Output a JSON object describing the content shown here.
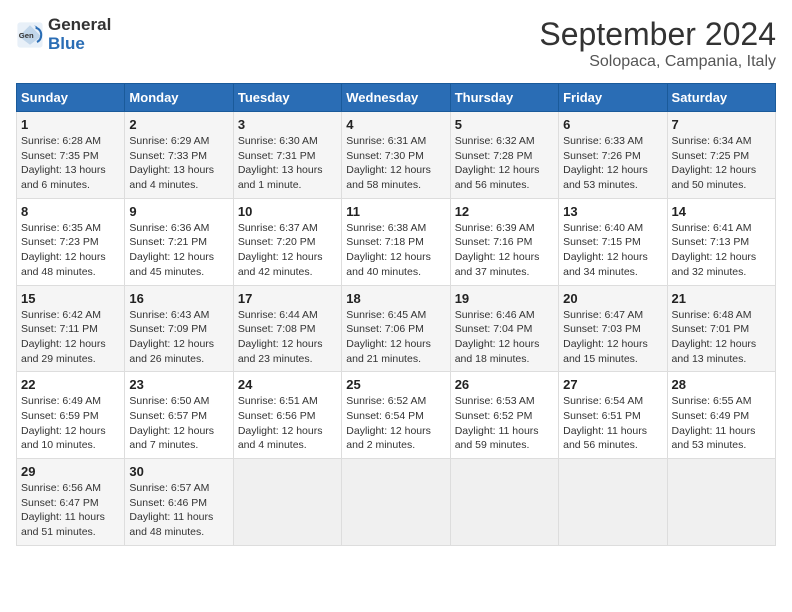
{
  "logo": {
    "text_general": "General",
    "text_blue": "Blue"
  },
  "header": {
    "month": "September 2024",
    "location": "Solopaca, Campania, Italy"
  },
  "days_of_week": [
    "Sunday",
    "Monday",
    "Tuesday",
    "Wednesday",
    "Thursday",
    "Friday",
    "Saturday"
  ],
  "weeks": [
    [
      {
        "day": "1",
        "info": "Sunrise: 6:28 AM\nSunset: 7:35 PM\nDaylight: 13 hours\nand 6 minutes."
      },
      {
        "day": "2",
        "info": "Sunrise: 6:29 AM\nSunset: 7:33 PM\nDaylight: 13 hours\nand 4 minutes."
      },
      {
        "day": "3",
        "info": "Sunrise: 6:30 AM\nSunset: 7:31 PM\nDaylight: 13 hours\nand 1 minute."
      },
      {
        "day": "4",
        "info": "Sunrise: 6:31 AM\nSunset: 7:30 PM\nDaylight: 12 hours\nand 58 minutes."
      },
      {
        "day": "5",
        "info": "Sunrise: 6:32 AM\nSunset: 7:28 PM\nDaylight: 12 hours\nand 56 minutes."
      },
      {
        "day": "6",
        "info": "Sunrise: 6:33 AM\nSunset: 7:26 PM\nDaylight: 12 hours\nand 53 minutes."
      },
      {
        "day": "7",
        "info": "Sunrise: 6:34 AM\nSunset: 7:25 PM\nDaylight: 12 hours\nand 50 minutes."
      }
    ],
    [
      {
        "day": "8",
        "info": "Sunrise: 6:35 AM\nSunset: 7:23 PM\nDaylight: 12 hours\nand 48 minutes."
      },
      {
        "day": "9",
        "info": "Sunrise: 6:36 AM\nSunset: 7:21 PM\nDaylight: 12 hours\nand 45 minutes."
      },
      {
        "day": "10",
        "info": "Sunrise: 6:37 AM\nSunset: 7:20 PM\nDaylight: 12 hours\nand 42 minutes."
      },
      {
        "day": "11",
        "info": "Sunrise: 6:38 AM\nSunset: 7:18 PM\nDaylight: 12 hours\nand 40 minutes."
      },
      {
        "day": "12",
        "info": "Sunrise: 6:39 AM\nSunset: 7:16 PM\nDaylight: 12 hours\nand 37 minutes."
      },
      {
        "day": "13",
        "info": "Sunrise: 6:40 AM\nSunset: 7:15 PM\nDaylight: 12 hours\nand 34 minutes."
      },
      {
        "day": "14",
        "info": "Sunrise: 6:41 AM\nSunset: 7:13 PM\nDaylight: 12 hours\nand 32 minutes."
      }
    ],
    [
      {
        "day": "15",
        "info": "Sunrise: 6:42 AM\nSunset: 7:11 PM\nDaylight: 12 hours\nand 29 minutes."
      },
      {
        "day": "16",
        "info": "Sunrise: 6:43 AM\nSunset: 7:09 PM\nDaylight: 12 hours\nand 26 minutes."
      },
      {
        "day": "17",
        "info": "Sunrise: 6:44 AM\nSunset: 7:08 PM\nDaylight: 12 hours\nand 23 minutes."
      },
      {
        "day": "18",
        "info": "Sunrise: 6:45 AM\nSunset: 7:06 PM\nDaylight: 12 hours\nand 21 minutes."
      },
      {
        "day": "19",
        "info": "Sunrise: 6:46 AM\nSunset: 7:04 PM\nDaylight: 12 hours\nand 18 minutes."
      },
      {
        "day": "20",
        "info": "Sunrise: 6:47 AM\nSunset: 7:03 PM\nDaylight: 12 hours\nand 15 minutes."
      },
      {
        "day": "21",
        "info": "Sunrise: 6:48 AM\nSunset: 7:01 PM\nDaylight: 12 hours\nand 13 minutes."
      }
    ],
    [
      {
        "day": "22",
        "info": "Sunrise: 6:49 AM\nSunset: 6:59 PM\nDaylight: 12 hours\nand 10 minutes."
      },
      {
        "day": "23",
        "info": "Sunrise: 6:50 AM\nSunset: 6:57 PM\nDaylight: 12 hours\nand 7 minutes."
      },
      {
        "day": "24",
        "info": "Sunrise: 6:51 AM\nSunset: 6:56 PM\nDaylight: 12 hours\nand 4 minutes."
      },
      {
        "day": "25",
        "info": "Sunrise: 6:52 AM\nSunset: 6:54 PM\nDaylight: 12 hours\nand 2 minutes."
      },
      {
        "day": "26",
        "info": "Sunrise: 6:53 AM\nSunset: 6:52 PM\nDaylight: 11 hours\nand 59 minutes."
      },
      {
        "day": "27",
        "info": "Sunrise: 6:54 AM\nSunset: 6:51 PM\nDaylight: 11 hours\nand 56 minutes."
      },
      {
        "day": "28",
        "info": "Sunrise: 6:55 AM\nSunset: 6:49 PM\nDaylight: 11 hours\nand 53 minutes."
      }
    ],
    [
      {
        "day": "29",
        "info": "Sunrise: 6:56 AM\nSunset: 6:47 PM\nDaylight: 11 hours\nand 51 minutes."
      },
      {
        "day": "30",
        "info": "Sunrise: 6:57 AM\nSunset: 6:46 PM\nDaylight: 11 hours\nand 48 minutes."
      },
      {
        "day": "",
        "info": ""
      },
      {
        "day": "",
        "info": ""
      },
      {
        "day": "",
        "info": ""
      },
      {
        "day": "",
        "info": ""
      },
      {
        "day": "",
        "info": ""
      }
    ]
  ]
}
